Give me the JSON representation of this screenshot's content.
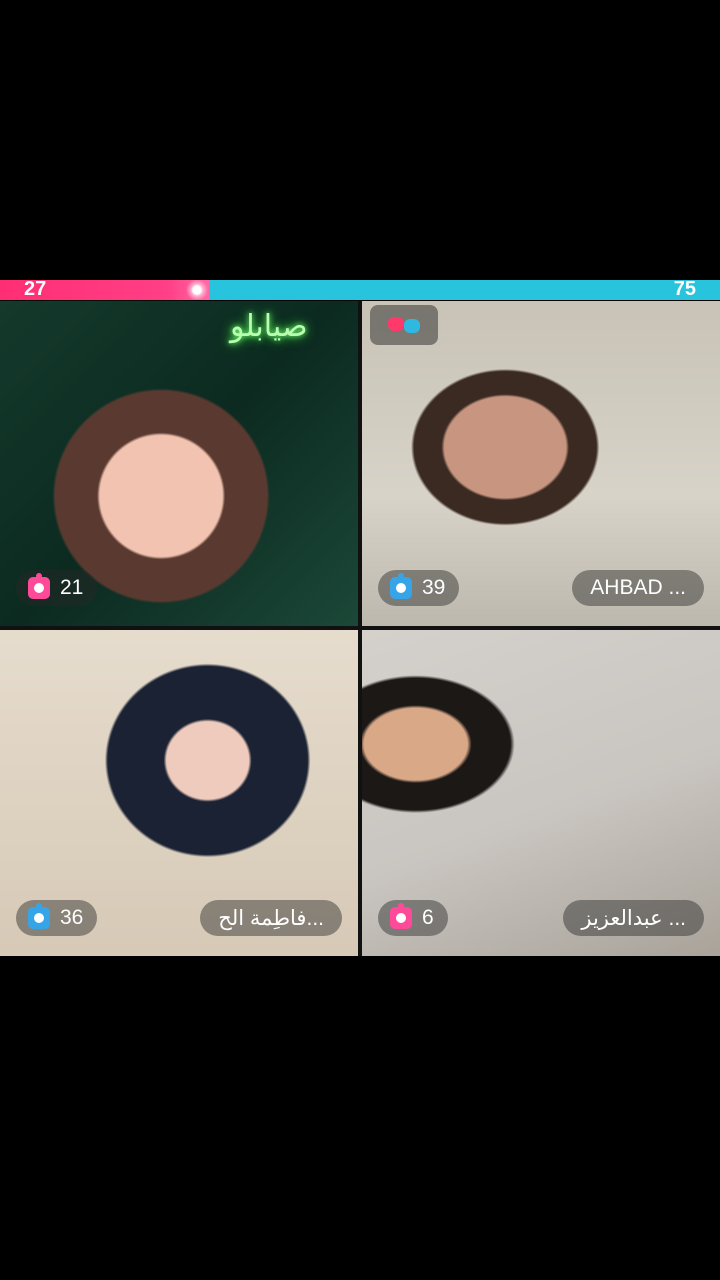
{
  "battle": {
    "left_score": "27",
    "right_score": "75",
    "left_share": 0.29,
    "left_color": "#ff2e74",
    "right_color": "#28c3dc"
  },
  "participants": [
    {
      "gift_count": "21",
      "gift_icon": "gift-icon",
      "gift_icon_color": "#ff4a9a",
      "name": ""
    },
    {
      "gift_count": "39",
      "gift_icon": "gift-icon",
      "gift_icon_color": "#35a5e8",
      "name": "AHBAD ...",
      "mode_icon": "boxing-gloves-icon"
    },
    {
      "gift_count": "36",
      "gift_icon": "gift-icon",
      "gift_icon_color": "#35a5e8",
      "name": "فاطِمة الح..."
    },
    {
      "gift_count": "6",
      "gift_icon": "gift-icon",
      "gift_icon_color": "#ff4a9a",
      "name": "عبدالعزيز ..."
    }
  ]
}
